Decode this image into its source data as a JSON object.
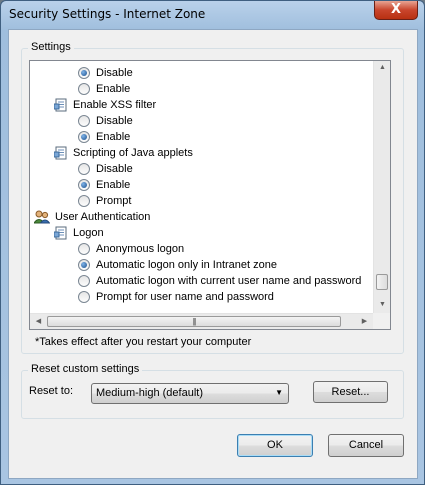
{
  "window": {
    "title": "Security Settings - Internet Zone",
    "close_glyph": "X"
  },
  "settings_group": {
    "label": "Settings"
  },
  "list": {
    "items": [
      {
        "kind": "radio",
        "label": "Disable",
        "checked": true
      },
      {
        "kind": "radio",
        "label": "Enable",
        "checked": false
      },
      {
        "kind": "header",
        "icon": "settings-page-icon",
        "label": "Enable XSS filter"
      },
      {
        "kind": "radio",
        "label": "Disable",
        "checked": false
      },
      {
        "kind": "radio",
        "label": "Enable",
        "checked": true
      },
      {
        "kind": "header",
        "icon": "settings-page-icon",
        "label": "Scripting of Java applets"
      },
      {
        "kind": "radio",
        "label": "Disable",
        "checked": false
      },
      {
        "kind": "radio",
        "label": "Enable",
        "checked": true
      },
      {
        "kind": "radio",
        "label": "Prompt",
        "checked": false
      },
      {
        "kind": "category",
        "icon": "users-icon",
        "label": "User Authentication"
      },
      {
        "kind": "header",
        "icon": "settings-page-icon",
        "label": "Logon"
      },
      {
        "kind": "radio",
        "label": "Anonymous logon",
        "checked": false
      },
      {
        "kind": "radio",
        "label": "Automatic logon only in Intranet zone",
        "checked": true
      },
      {
        "kind": "radio",
        "label": "Automatic logon with current user name and password",
        "checked": false
      },
      {
        "kind": "radio",
        "label": "Prompt for user name and password",
        "checked": false
      }
    ]
  },
  "note": "*Takes effect after you restart your computer",
  "reset_group": {
    "label": "Reset custom settings",
    "reset_to_label": "Reset to:",
    "selected": "Medium-high (default)",
    "reset_button": "Reset..."
  },
  "buttons": {
    "ok": "OK",
    "cancel": "Cancel"
  },
  "icons": {
    "up_arrow": "▲",
    "down_arrow": "▼",
    "left_arrow": "◀",
    "right_arrow": "▶",
    "grip": "|||",
    "dropdown": "▼"
  },
  "colors": {
    "accent": "#3c7fb1",
    "title_bar": "#b9d1ea"
  }
}
